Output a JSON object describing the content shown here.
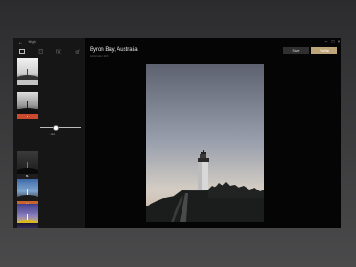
{
  "app": {
    "title": "Hilight"
  },
  "sidebar": {
    "back_glyph": "←",
    "tools": [
      "crop-icon",
      "adjust-icon",
      "filter-icon",
      "share-icon"
    ],
    "thumbnails": [
      {
        "tag": "",
        "tag_color": "#c4c4c4"
      },
      {
        "tag": "B",
        "tag_color": "#c94a2e"
      },
      {
        "tag": "BL",
        "tag_color": "#1e1e1e"
      },
      {
        "tag": "LY",
        "tag_color": "#c9632e"
      },
      {
        "tag": "",
        "tag_color": "#e0c12a"
      },
      {
        "tag": "",
        "tag_color": "#c9b060"
      }
    ],
    "slider_value": "+3.9",
    "slider_level": 0.33
  },
  "photo": {
    "title": "Byron Bay, Australia",
    "date": "12 October 2017"
  },
  "toolbar": {
    "save_label": "Save",
    "publish_label": "Publish"
  },
  "window_controls": {
    "minimize": "–",
    "maximize": "□",
    "close": "×"
  },
  "colors": {
    "accent": "#bfa57a",
    "window_bg": "#050505",
    "sidebar_bg": "#161616"
  }
}
